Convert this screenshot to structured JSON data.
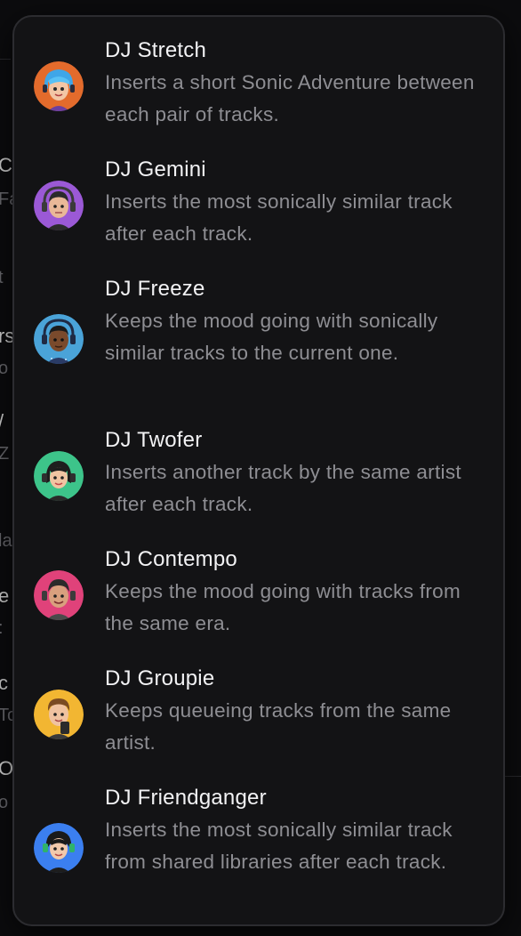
{
  "background": {
    "fragments": [
      "Co",
      "Fa",
      "t",
      "rs",
      "o",
      "/",
      "Z",
      "la",
      "e",
      ":",
      "c",
      "To",
      "Or",
      "o"
    ]
  },
  "menu": {
    "items": [
      {
        "name": "DJ Stretch",
        "description": "Inserts a short Sonic Adventure between each pair of tracks.",
        "avatar": "dj-stretch-avatar-icon",
        "color": "#e36b2c"
      },
      {
        "name": "DJ Gemini",
        "description": "Inserts the most sonically similar track after each track.",
        "avatar": "dj-gemini-avatar-icon",
        "color": "#9b59d6"
      },
      {
        "name": "DJ Freeze",
        "description": "Keeps the mood going with sonically similar tracks to the current one.",
        "avatar": "dj-freeze-avatar-icon",
        "color": "#4aa3d8"
      },
      {
        "name": "DJ Twofer",
        "description": "Inserts another track by the same artist after each track.",
        "avatar": "dj-twofer-avatar-icon",
        "color": "#3dc48a"
      },
      {
        "name": "DJ Contempo",
        "description": "Keeps the mood going with tracks from the same era.",
        "avatar": "dj-contempo-avatar-icon",
        "color": "#e0427a"
      },
      {
        "name": "DJ Groupie",
        "description": "Keeps queueing tracks from the same artist.",
        "avatar": "dj-groupie-avatar-icon",
        "color": "#f2b632"
      },
      {
        "name": "DJ Friendganger",
        "description": "Inserts the most sonically similar track from shared libraries after each track.",
        "avatar": "dj-friendganger-avatar-icon",
        "color": "#3b7ff0"
      }
    ]
  }
}
